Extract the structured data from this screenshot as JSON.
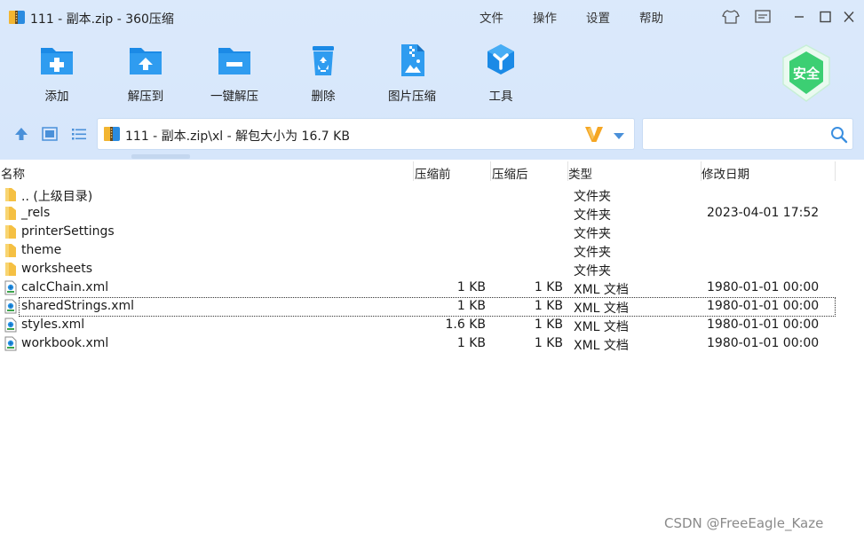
{
  "window": {
    "title": "111 - 副本.zip - 360压缩"
  },
  "menu": {
    "file": "文件",
    "operate": "操作",
    "settings": "设置",
    "help": "帮助"
  },
  "toolbar": {
    "add": "添加",
    "extract_to": "解压到",
    "one_click_extract": "一键解压",
    "delete": "删除",
    "image_compress": "图片压缩",
    "tools": "工具"
  },
  "safe_badge": "安全",
  "address": {
    "path_text": "111 - 副本.zip\\xl - 解包大小为 16.7 KB"
  },
  "search": {
    "value": "",
    "placeholder": ""
  },
  "columns": {
    "name": "名称",
    "packed": "压缩前",
    "size": "压缩后",
    "type": "类型",
    "modified": "修改日期"
  },
  "files": [
    {
      "name": ".. (上级目录)",
      "packed": "",
      "size": "",
      "type": "文件夹",
      "modified": "",
      "icon": "folder-icon"
    },
    {
      "name": "_rels",
      "packed": "",
      "size": "",
      "type": "文件夹",
      "modified": "2023-04-01 17:52",
      "icon": "folder-icon"
    },
    {
      "name": "printerSettings",
      "packed": "",
      "size": "",
      "type": "文件夹",
      "modified": "",
      "icon": "folder-icon"
    },
    {
      "name": "theme",
      "packed": "",
      "size": "",
      "type": "文件夹",
      "modified": "",
      "icon": "folder-icon"
    },
    {
      "name": "worksheets",
      "packed": "",
      "size": "",
      "type": "文件夹",
      "modified": "",
      "icon": "folder-icon"
    },
    {
      "name": "calcChain.xml",
      "packed": "1 KB",
      "size": "1 KB",
      "type": "XML 文档",
      "modified": "1980-01-01 00:00",
      "icon": "xml-file-icon"
    },
    {
      "name": "sharedStrings.xml",
      "packed": "1 KB",
      "size": "1 KB",
      "type": "XML 文档",
      "modified": "1980-01-01 00:00",
      "icon": "xml-file-icon"
    },
    {
      "name": "styles.xml",
      "packed": "1.6 KB",
      "size": "1 KB",
      "type": "XML 文档",
      "modified": "1980-01-01 00:00",
      "icon": "xml-file-icon"
    },
    {
      "name": "workbook.xml",
      "packed": "1 KB",
      "size": "1 KB",
      "type": "XML 文档",
      "modified": "1980-01-01 00:00",
      "icon": "xml-file-icon"
    }
  ],
  "focused_row": "sharedStrings.xml",
  "watermark": "CSDN @FreeEagle_Kaze",
  "colors": {
    "accent": "#1f8fe8",
    "header_bg": "#d7e7fb",
    "folder": "#f5c043",
    "safe_green": "#3ccf73"
  }
}
